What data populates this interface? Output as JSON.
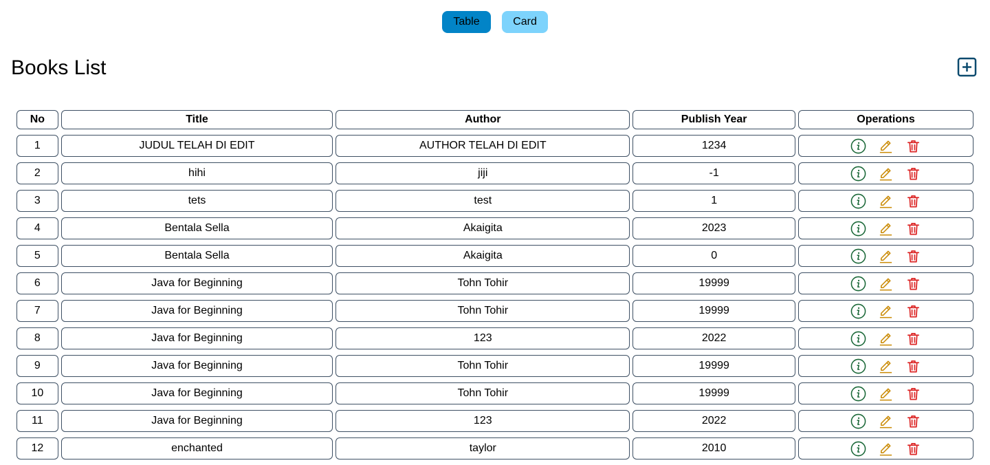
{
  "view_toggle": {
    "table_label": "Table",
    "card_label": "Card"
  },
  "header": {
    "title": "Books List",
    "add_icon": "plus-square-icon"
  },
  "table": {
    "columns": [
      "No",
      "Title",
      "Author",
      "Publish Year",
      "Operations"
    ],
    "rows": [
      {
        "no": "1",
        "title": "JUDUL TELAH DI EDIT",
        "author": "AUTHOR TELAH DI EDIT",
        "year": "1234"
      },
      {
        "no": "2",
        "title": "hihi",
        "author": "jiji",
        "year": "-1"
      },
      {
        "no": "3",
        "title": "tets",
        "author": "test",
        "year": "1"
      },
      {
        "no": "4",
        "title": "Bentala Sella",
        "author": "Akaigita",
        "year": "2023"
      },
      {
        "no": "5",
        "title": "Bentala Sella",
        "author": "Akaigita",
        "year": "0"
      },
      {
        "no": "6",
        "title": "Java for Beginning",
        "author": "Tohn Tohir",
        "year": "19999"
      },
      {
        "no": "7",
        "title": "Java for Beginning",
        "author": "Tohn Tohir",
        "year": "19999"
      },
      {
        "no": "8",
        "title": "Java for Beginning",
        "author": "123",
        "year": "2022"
      },
      {
        "no": "9",
        "title": "Java for Beginning",
        "author": "Tohn Tohir",
        "year": "19999"
      },
      {
        "no": "10",
        "title": "Java for Beginning",
        "author": "Tohn Tohir",
        "year": "19999"
      },
      {
        "no": "11",
        "title": "Java for Beginning",
        "author": "123",
        "year": "2022"
      },
      {
        "no": "12",
        "title": "enchanted",
        "author": "taylor",
        "year": "2010"
      }
    ],
    "operation_icons": [
      "info-circle-icon",
      "pencil-edit-icon",
      "trash-icon"
    ]
  },
  "colors": {
    "table_button": "#0284c7",
    "card_button": "#7dd3fc",
    "add_icon": "#0c4a6e",
    "info_icon": "#166534",
    "edit_icon": "#ca8a04",
    "delete_icon": "#dc2626",
    "cell_border": "#3d4f63"
  }
}
